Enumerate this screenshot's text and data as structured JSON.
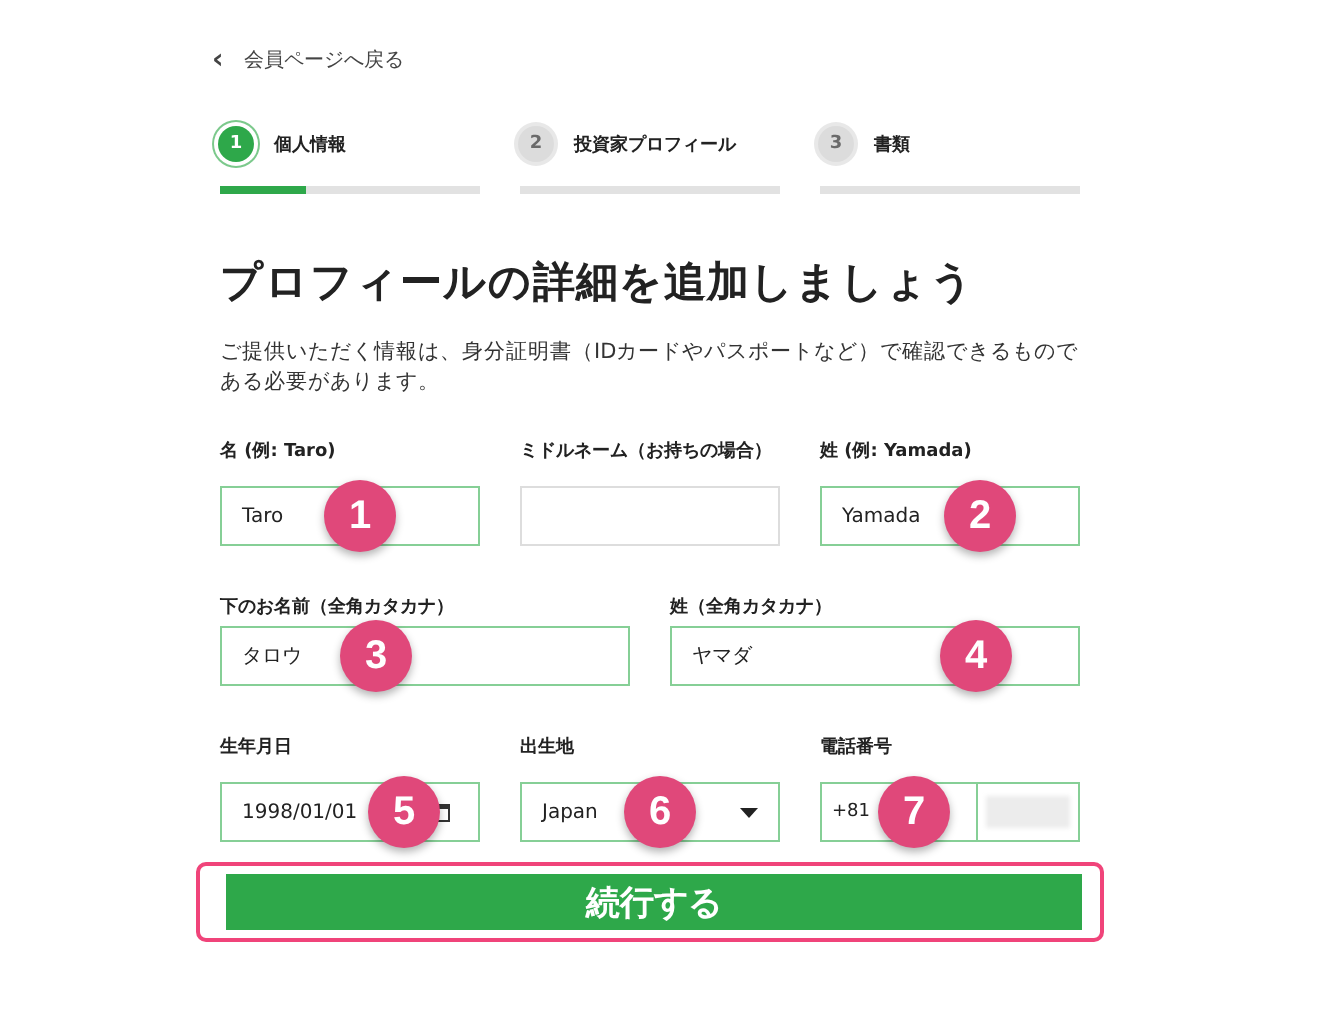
{
  "back_link": {
    "icon": "‹",
    "label": "会員ページへ戻る"
  },
  "steps": [
    {
      "number": "1",
      "label": "個人情報",
      "selected": true,
      "level": 0.33
    },
    {
      "number": "2",
      "label": "投資家プロフィール",
      "selected": false
    },
    {
      "number": "3",
      "label": "書類",
      "selected": false
    }
  ],
  "title": "プロフィールの詳細を追加しましょう",
  "description": "ご提供いただく情報は、身分証明書（IDカードやパスポートなど）で確認できるものである必要があります。",
  "form_rows": [
    {
      "fields": [
        {
          "kind": "text",
          "label": "名 (例: Taro)",
          "value": "Taro",
          "badge": "1",
          "valid": true
        },
        {
          "kind": "text",
          "label": "ミドルネーム（お持ちの場合）",
          "valid": false
        },
        {
          "kind": "text",
          "label": "姓 (例: Yamada)",
          "value": "Yamada",
          "badge": "2",
          "valid": true
        }
      ]
    },
    {
      "fields": [
        {
          "kind": "text",
          "label": "下のお名前（全角カタカナ）",
          "value": "タロウ",
          "badge": "3",
          "valid": true
        },
        {
          "kind": "text",
          "label": "姓（全角カタカナ）",
          "value": "ヤマダ",
          "badge": "4",
          "valid": true
        }
      ]
    },
    {
      "fields": [
        {
          "kind": "date",
          "label": "生年月日",
          "value": "1998/01/01",
          "badge": "5",
          "valid": true
        },
        {
          "kind": "select",
          "label": "出生地",
          "value": "Japan",
          "badge": "6",
          "valid": true
        },
        {
          "kind": "phone",
          "label": "電話番号",
          "code": "+81",
          "badge": "7",
          "valid": true
        }
      ]
    }
  ],
  "submit": {
    "label": "続行する",
    "highlighted": true
  }
}
